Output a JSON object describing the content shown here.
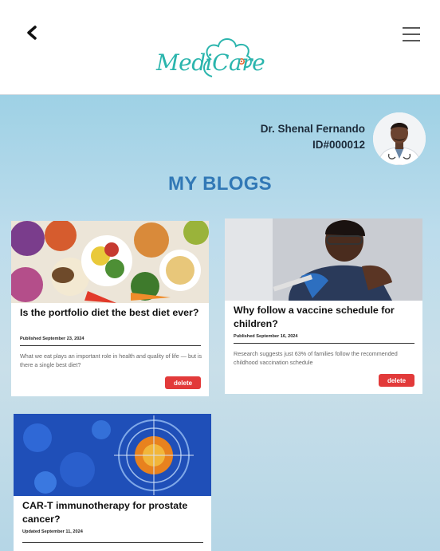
{
  "header": {
    "logo_text": "MediCare"
  },
  "doctor": {
    "name": "Dr. Shenal Fernando",
    "id": "ID#000012"
  },
  "page": {
    "title": "MY BLOGS"
  },
  "blogs": [
    {
      "title": "Is the portfolio diet the best diet ever?",
      "date": "Published September 23, 2024",
      "excerpt": "What we eat plays an important role in health and quality of life — but is there a single best diet?",
      "delete_label": "delete"
    },
    {
      "title": "Why follow a vaccine schedule for children?",
      "date": "Published September 16, 2024",
      "excerpt": "Research suggests just 63% of families follow the recommended childhood vaccination schedule",
      "delete_label": "delete"
    },
    {
      "title": "CAR-T immunotherapy for prostate cancer?",
      "date": "Updated September 11, 2024",
      "excerpt": "",
      "delete_label": ""
    }
  ],
  "colors": {
    "brand_teal": "#2bb5ad",
    "title_blue": "#3178b6",
    "delete_red": "#e23a3a"
  },
  "icons": {
    "back": "chevron-left-icon",
    "menu": "hamburger-menu-icon"
  }
}
